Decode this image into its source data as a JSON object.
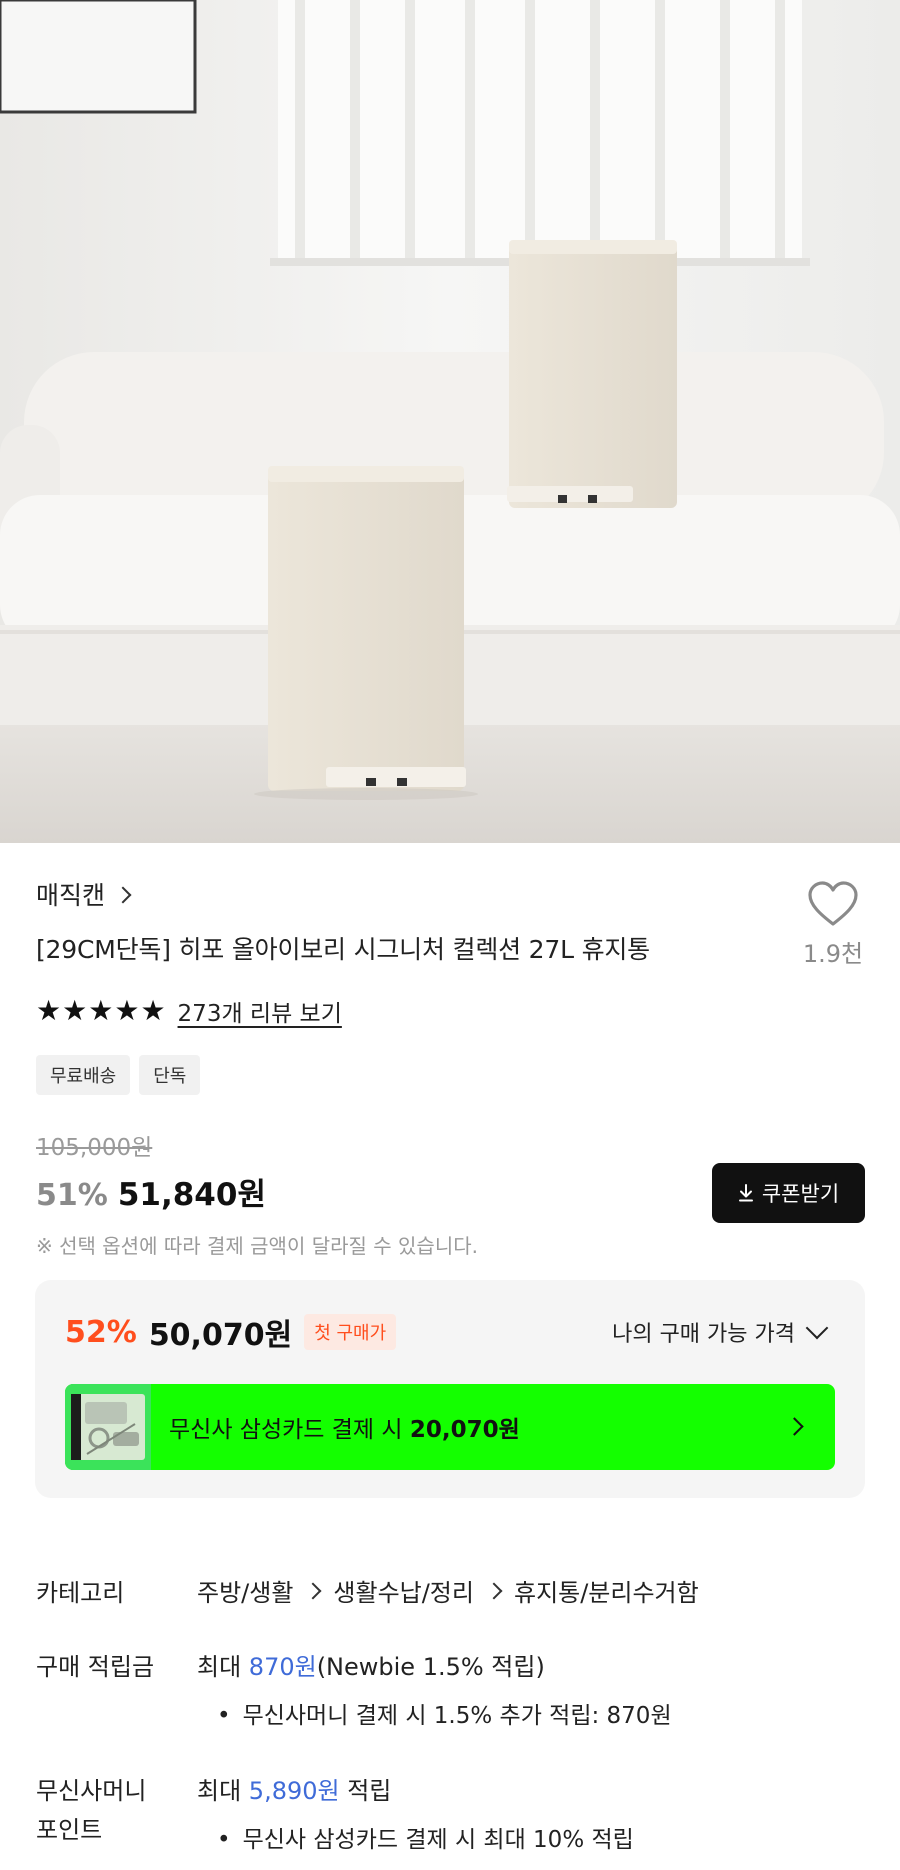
{
  "product": {
    "brand": "매직캔",
    "title": "[29CM단독] 히포 올아이보리 시그니처 컬렉션 27L 휴지통",
    "like_count": "1.9천",
    "rating_stars": 5,
    "review_link": "273개 리뷰 보기",
    "badges": [
      "무료배송",
      "단독"
    ]
  },
  "pricing": {
    "original_price": "105,000원",
    "discount": "51%",
    "price": "51,840원",
    "coupon_button": "쿠폰받기",
    "notice": "※ 선택 옵션에 따라 결제 금액이 달라질 수 있습니다."
  },
  "purchase_box": {
    "discount": "52%",
    "price": "50,070원",
    "first_purchase_badge": "첫 구매가",
    "my_price_label": "나의 구매 가능 가격",
    "card_banner_prefix": "무신사 삼성카드 결제 시 ",
    "card_banner_price": "20,070원"
  },
  "info": {
    "category_label": "카테고리",
    "category_path": [
      "주방/생활",
      "생활수납/정리",
      "휴지통/분리수거함"
    ],
    "points_label": "구매 적립금",
    "points_prefix": "최대 ",
    "points_amount": "870원",
    "points_suffix": "(Newbie 1.5% 적립)",
    "points_bullet": "무신사머니 결제 시 1.5% 추가 적립: 870원",
    "money_label_line1": "무신사머니",
    "money_label_line2": "포인트",
    "money_prefix": "최대 ",
    "money_amount": "5,890원",
    "money_suffix": " 적립",
    "money_bullet": "무신사 삼성카드 결제 시 최대 10% 적립"
  },
  "colors": {
    "accent_orange": "#ff4e1d",
    "banner_green": "#14ff00",
    "link_blue": "#3f6bd8"
  }
}
